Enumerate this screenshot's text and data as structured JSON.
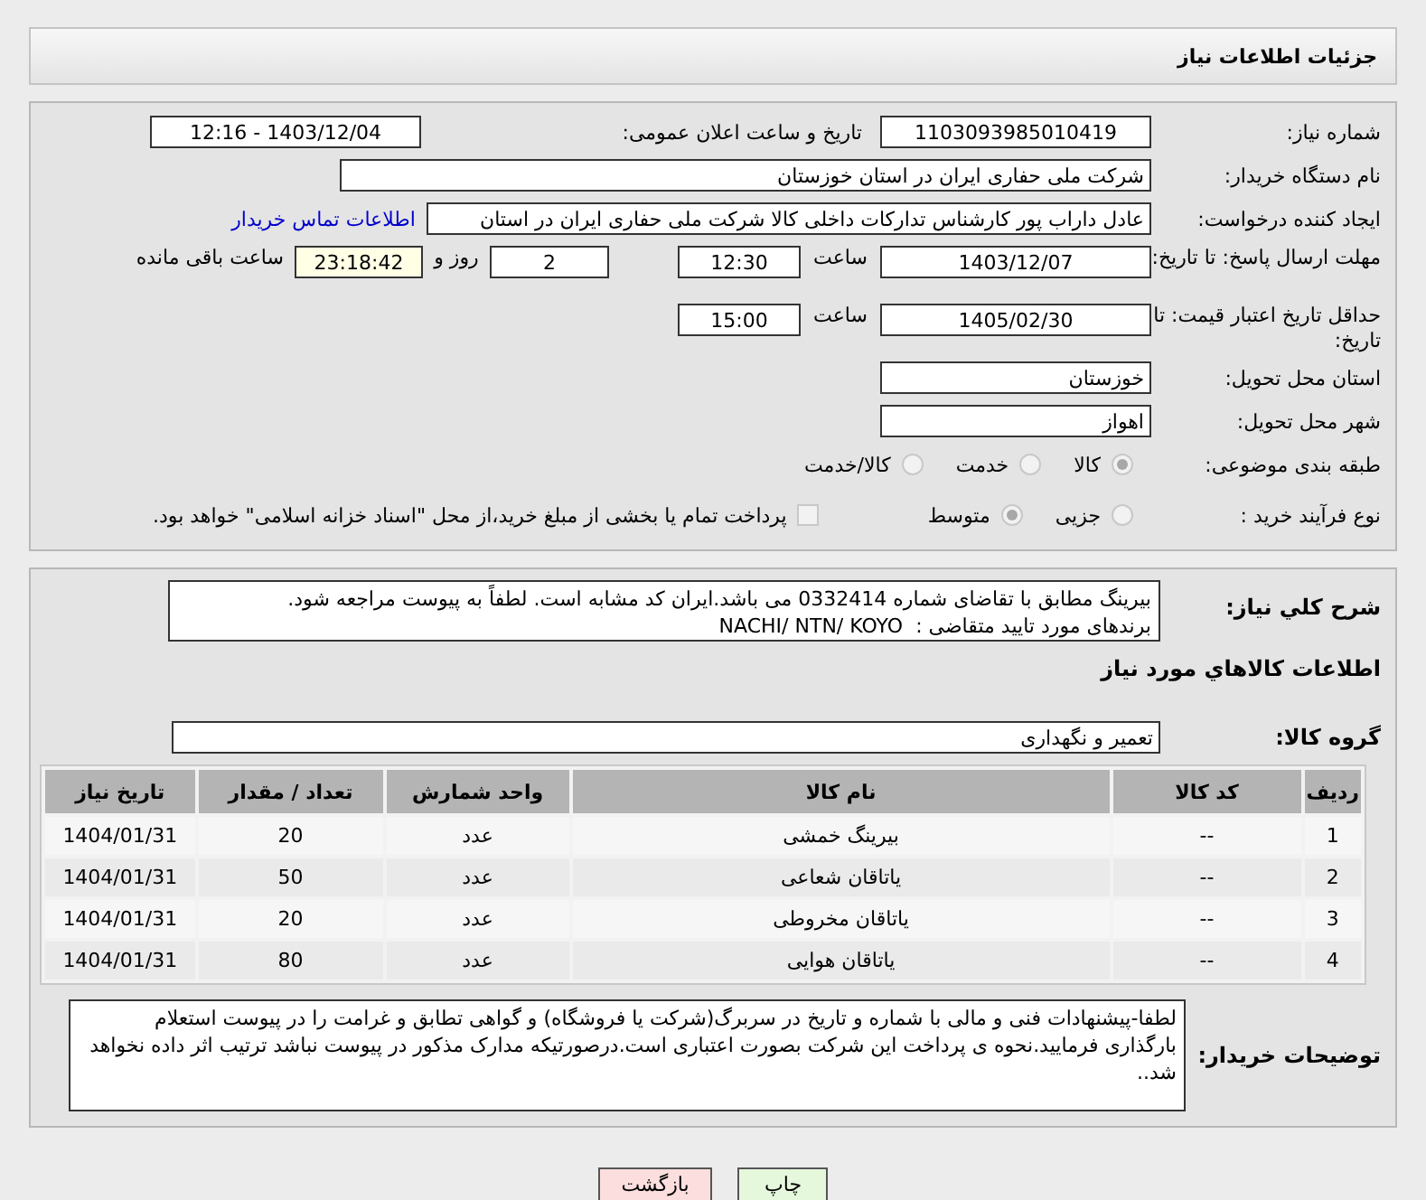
{
  "header": {
    "title": "جزئیات اطلاعات نیاز"
  },
  "details": {
    "need_number": {
      "label": "شماره نیاز:",
      "value": "1103093985010419"
    },
    "announce": {
      "label": "تاریخ و ساعت اعلان عمومی:",
      "value": "1403/12/04 - 12:16"
    },
    "buyer": {
      "label": "نام دستگاه خریدار:",
      "value": "شرکت ملی حفاری ایران در استان خوزستان"
    },
    "creator": {
      "label": "ایجاد کننده درخواست:",
      "value": "عادل داراب پور کارشناس تدارکات داخلی کالا شرکت ملی حفاری ایران در استان",
      "link": "اطلاعات تماس خریدار"
    },
    "deadline": {
      "label": "مهلت ارسال پاسخ: تا تاریخ:",
      "date": "1403/12/07",
      "time_label": "ساعت",
      "time": "12:30",
      "days": "2",
      "days_label": "روز و",
      "remaining": "23:18:42",
      "remaining_label": "ساعت باقی مانده"
    },
    "validity": {
      "label": "حداقل تاریخ اعتبار قیمت: تا تاریخ:",
      "date": "1405/02/30",
      "time_label": "ساعت",
      "time": "15:00"
    },
    "province": {
      "label": "استان محل تحویل:",
      "value": "خوزستان"
    },
    "city": {
      "label": "شهر محل تحویل:",
      "value": "اهواز"
    },
    "category": {
      "label": "طبقه بندی موضوعی:",
      "options": [
        {
          "label": "کالا",
          "selected": true
        },
        {
          "label": "خدمت",
          "selected": false
        },
        {
          "label": "کالا/خدمت",
          "selected": false
        }
      ]
    },
    "process": {
      "label": "نوع فرآیند خرید :",
      "options": [
        {
          "label": "جزیی",
          "selected": false
        },
        {
          "label": "متوسط",
          "selected": true
        }
      ],
      "treasury": {
        "label": "پرداخت تمام یا بخشی از مبلغ خرید،از محل \"اسناد خزانه اسلامی\" خواهد بود.",
        "checked": false
      }
    }
  },
  "description": {
    "label": "شرح کلي نياز:",
    "text": "بيرينگ مطابق با تقاضای شماره 0332414 می باشد.ایران کد مشابه است. لطفاً به پیوست مراجعه شود.\nبرندهای مورد تایید متقاضی :  NACHI/ NTN/ KOYO"
  },
  "goods": {
    "title": "اطلاعات کالاهاي مورد نياز",
    "group": {
      "label": "گروه کالا:",
      "value": "تعمیر و نگهداری"
    },
    "table": {
      "columns": [
        "رديف",
        "کد کالا",
        "نام کالا",
        "واحد شمارش",
        "تعداد / مقدار",
        "تاریخ نیاز"
      ],
      "rows": [
        [
          "1",
          "--",
          "بیرینگ خمشی",
          "عدد",
          "20",
          "1404/01/31"
        ],
        [
          "2",
          "--",
          "یاتاقان شعاعی",
          "عدد",
          "50",
          "1404/01/31"
        ],
        [
          "3",
          "--",
          "یاتاقان مخروطی",
          "عدد",
          "20",
          "1404/01/31"
        ],
        [
          "4",
          "--",
          "یاتاقان هوایی",
          "عدد",
          "80",
          "1404/01/31"
        ]
      ]
    }
  },
  "buyer_notes": {
    "label": "توضيحات خريدار:",
    "text": "لطفا-پیشنهادات فنی و مالی با شماره و تاریخ در سربرگ(شرکت یا فروشگاه) و گواهی تطابق و غرامت را در پیوست استعلام بارگذاری فرمایید.نحوه ی پرداخت این شرکت بصورت اعتباری است.درصورتیکه مدارک مذکور در پیوست نباشد ترتیب اثر داده نخواهد شد.."
  },
  "buttons": [
    {
      "label": "چاپ",
      "kind": "print"
    },
    {
      "label": "بازگشت",
      "kind": "back"
    }
  ]
}
